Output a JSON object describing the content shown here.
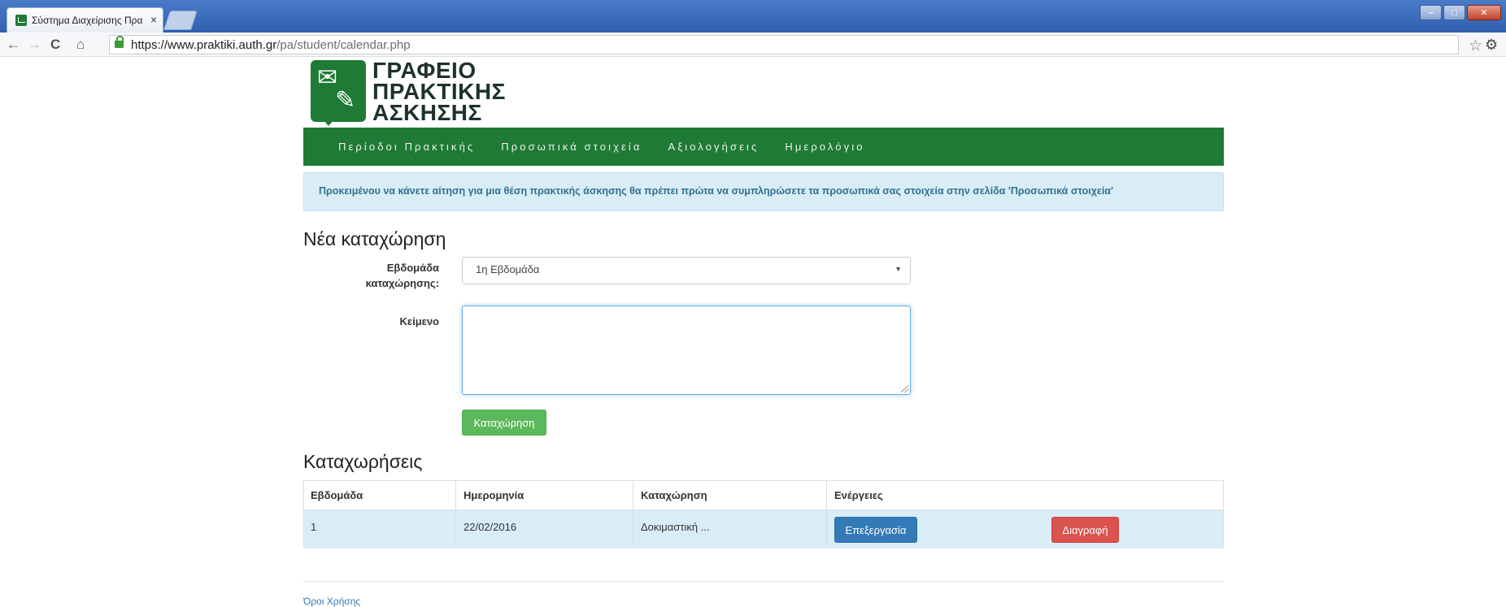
{
  "browser": {
    "tab_title": "Σύστημα Διαχείρισης Πρα",
    "tab_close": "×",
    "url_host": "https://www.praktiki.auth.gr",
    "url_path": "/pa/student/calendar.php",
    "icons": {
      "back": "←",
      "forward": "→",
      "reload": "C",
      "home": "⌂",
      "star": "☆",
      "settings": "⚙",
      "menu": "⋮"
    }
  },
  "window_controls": {
    "minimize": "–",
    "maximize": "□",
    "close": "✕"
  },
  "site": {
    "logo_lines": [
      "ΓΡΑΦΕΙΟ",
      "ΠΡΑΚΤΙΚΗΣ",
      "ΑΣΚΗΣΗΣ"
    ],
    "logo_color": "#1f7a35"
  },
  "nav": {
    "items": [
      {
        "label": "Περίοδοι Πρακτικής"
      },
      {
        "label": "Προσωπικά στοιχεία"
      },
      {
        "label": "Αξιολογήσεις"
      },
      {
        "label": "Ημερολόγιο"
      }
    ]
  },
  "alert": {
    "text": "Προκειμένου να κάνετε αίτηση για μια θέση πρακτικής άσκησης θα πρέπει πρώτα να συμπληρώσετε τα προσωπικά σας στοιχεία στην σελίδα 'Προσωπικά στοιχεία'"
  },
  "form": {
    "title": "Νέα καταχώρηση",
    "week_label_line1": "Εβδομάδα",
    "week_label_line2": "καταχώρησης:",
    "week_selected": "1η Εβδομάδα",
    "text_label": "Κείμενο",
    "text_value": "",
    "submit_label": "Καταχώρηση"
  },
  "entries": {
    "title": "Καταχωρήσεις",
    "headers": [
      "Εβδομάδα",
      "Ημερομηνία",
      "Καταχώρηση",
      "Ενέργειες"
    ],
    "rows": [
      {
        "week": "1",
        "date": "22/02/2016",
        "entry": "Δοκιμαστική ...",
        "edit_label": "Επεξεργασία",
        "delete_label": "Διαγραφή"
      }
    ]
  },
  "footer": {
    "terms_link": "Όροι Χρήσης"
  },
  "colors": {
    "primary": "#337ab7",
    "success": "#5cb85c",
    "danger": "#d9534f",
    "info_bg": "#d9edf7"
  }
}
